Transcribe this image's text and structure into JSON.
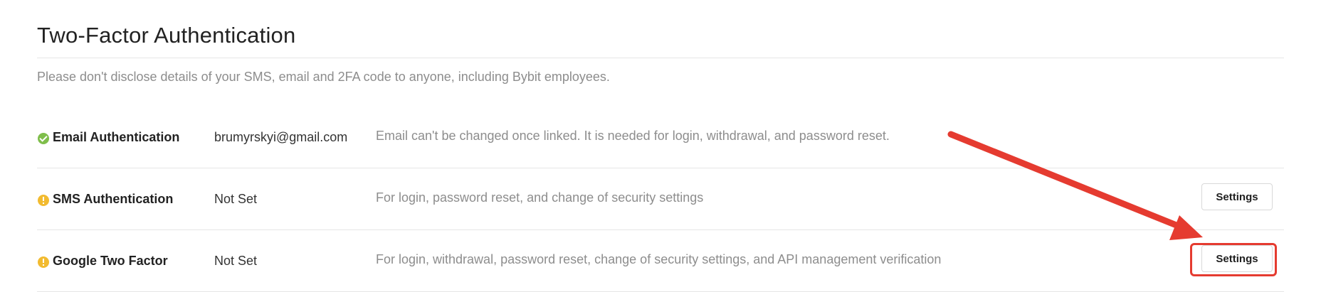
{
  "page": {
    "title": "Two-Factor Authentication",
    "subtitle": "Please don't disclose details of your SMS, email and 2FA code to anyone, including Bybit employees."
  },
  "methods": [
    {
      "name": "Email Authentication",
      "status": "brumyrskyi@gmail.com",
      "description": "Email can't be changed once linked. It is needed for login, withdrawal, and password reset.",
      "state": "verified",
      "status_color": "#7fbe4b"
    },
    {
      "name": "SMS Authentication",
      "status": "Not Set",
      "description": "For login, password reset, and change of security settings",
      "state": "warning",
      "status_color": "#f2bb30",
      "action_label": "Settings"
    },
    {
      "name": "Google Two Factor",
      "status": "Not Set",
      "description": "For login, withdrawal, password reset, change of security settings, and API management verification",
      "state": "warning",
      "status_color": "#f2bb30",
      "action_label": "Settings"
    }
  ],
  "annotation": {
    "arrow_color": "#e53b30",
    "highlight_color": "#e53b30"
  }
}
